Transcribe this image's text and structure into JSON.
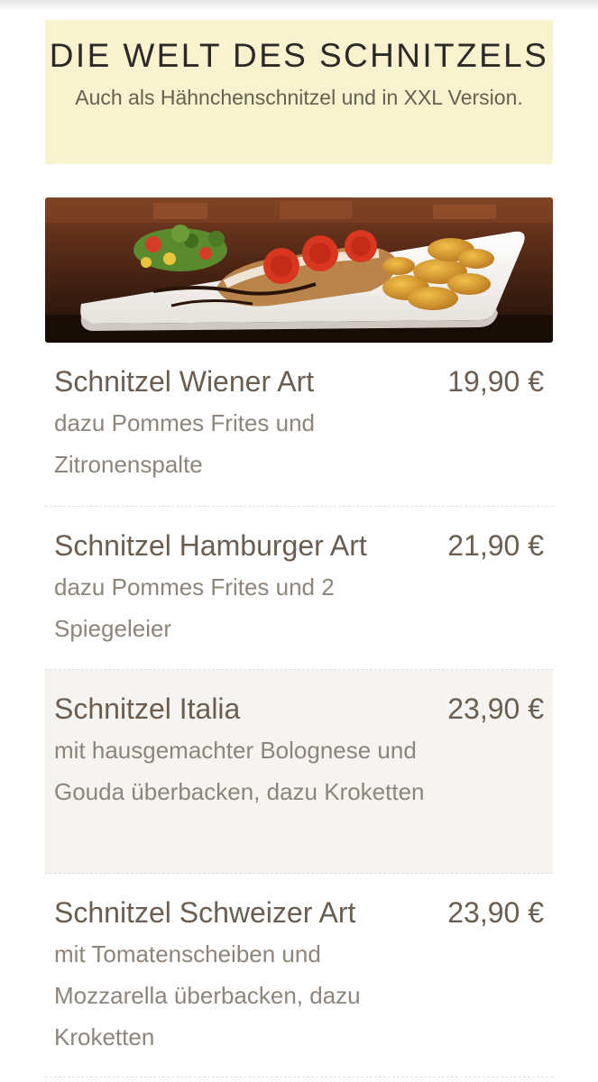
{
  "header": {
    "title": "DIE WELT DES SCHNITZELS",
    "subtitle": "Auch als Hähnchenschnitzel und in XXL Version."
  },
  "image": {
    "description_icon": "schnitzel-plate-photo"
  },
  "colors": {
    "header_background": "#f8f2cf",
    "text": "#6b5e50",
    "description_text": "#8d857b",
    "shaded_row": "#f6f4f1"
  },
  "menu": {
    "items": [
      {
        "name": "Schnitzel Wiener Art",
        "price": "19,90 €",
        "description": "dazu Pommes Frites und Zitronenspalte"
      },
      {
        "name": "Schnitzel Hamburger Art",
        "price": "21,90 €",
        "description": "dazu Pommes Frites und 2 Spiegeleier"
      },
      {
        "name": "Schnitzel Italia",
        "price": "23,90 €",
        "description": "mit hausgemachter Bolognese und Gouda überbacken, dazu Kroketten"
      },
      {
        "name": "Schnitzel Schweizer Art",
        "price": "23,90 €",
        "description": "mit Tomatenscheiben und Mozzarella überbacken, dazu Kroketten"
      }
    ]
  }
}
